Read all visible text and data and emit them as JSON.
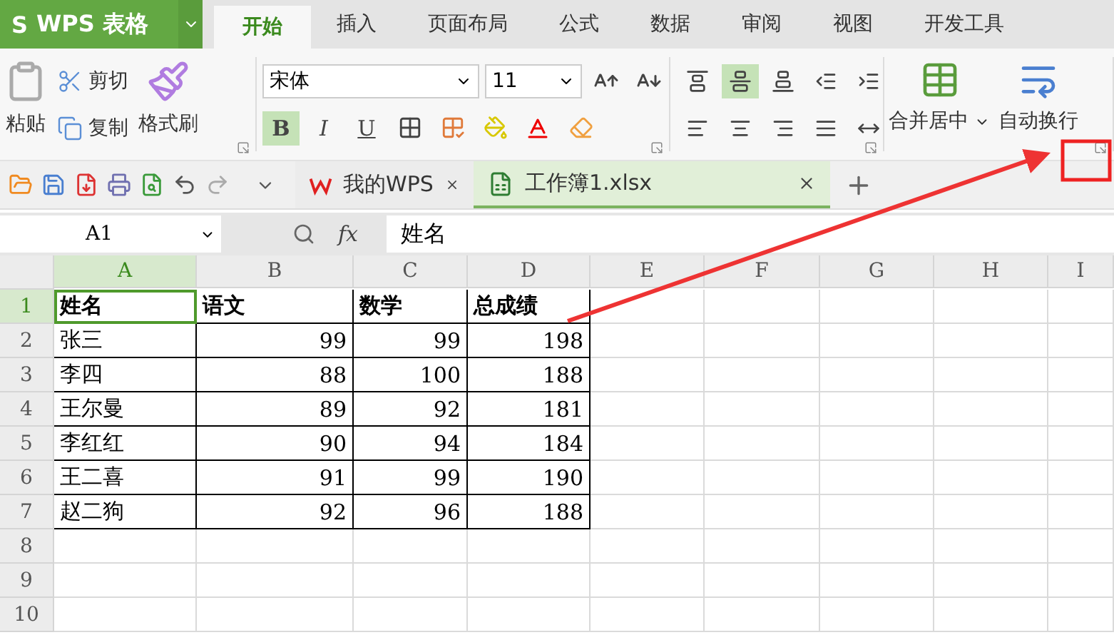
{
  "app": {
    "logo_mark": "S",
    "logo": "WPS 表格"
  },
  "tabs": [
    {
      "label": "开始",
      "selected": true
    },
    {
      "label": "插入",
      "selected": false
    },
    {
      "label": "页面布局",
      "selected": false
    },
    {
      "label": "公式",
      "selected": false
    },
    {
      "label": "数据",
      "selected": false
    },
    {
      "label": "审阅",
      "selected": false
    },
    {
      "label": "视图",
      "selected": false
    },
    {
      "label": "开发工具",
      "selected": false
    }
  ],
  "ribbon": {
    "paste": "粘贴",
    "cut": "剪切",
    "copy": "复制",
    "format_painter": "格式刷",
    "font_name": "宋体",
    "font_size": "11",
    "styles": [
      {
        "label": "B",
        "kind": "bold",
        "selected": true
      },
      {
        "label": "I",
        "kind": "italic",
        "selected": false
      },
      {
        "label": "U",
        "kind": "underline",
        "selected": false
      }
    ],
    "vertical_align": [
      {
        "kind": "top",
        "selected": false
      },
      {
        "kind": "middle",
        "selected": true
      },
      {
        "kind": "bottom",
        "selected": false
      }
    ],
    "merge": "合并居中",
    "wrap": "自动换行"
  },
  "doc_tabs": [
    {
      "label": "我的WPS",
      "selected": false
    },
    {
      "label": "工作簿1.xlsx",
      "selected": true
    }
  ],
  "formula_bar": {
    "cell_ref": "A1",
    "fx": "fx",
    "value": "姓名"
  },
  "sheet": {
    "columns": [
      {
        "label": "A",
        "selected": true
      },
      {
        "label": "B",
        "selected": false
      },
      {
        "label": "C",
        "selected": false
      },
      {
        "label": "D",
        "selected": false
      },
      {
        "label": "E",
        "selected": false
      },
      {
        "label": "F",
        "selected": false
      },
      {
        "label": "G",
        "selected": false
      },
      {
        "label": "H",
        "selected": false
      },
      {
        "label": "I",
        "selected": false
      }
    ],
    "rows": [
      {
        "label": "1",
        "kind": "header",
        "selected": true,
        "cells": [
          "姓名",
          "语文",
          "数学",
          "总成绩"
        ]
      },
      {
        "label": "2",
        "kind": "data",
        "selected": false,
        "cells": [
          "张三",
          "99",
          "99",
          "198"
        ]
      },
      {
        "label": "3",
        "kind": "data",
        "selected": false,
        "cells": [
          "李四",
          "88",
          "100",
          "188"
        ]
      },
      {
        "label": "4",
        "kind": "data",
        "selected": false,
        "cells": [
          "王尔曼",
          "89",
          "92",
          "181"
        ]
      },
      {
        "label": "5",
        "kind": "data",
        "selected": false,
        "cells": [
          "李红红",
          "90",
          "94",
          "184"
        ]
      },
      {
        "label": "6",
        "kind": "data",
        "selected": false,
        "cells": [
          "王二喜",
          "91",
          "99",
          "190"
        ]
      },
      {
        "label": "7",
        "kind": "data",
        "selected": false,
        "cells": [
          "赵二狗",
          "92",
          "96",
          "188"
        ]
      },
      {
        "label": "8",
        "kind": "data",
        "selected": false,
        "cells": []
      },
      {
        "label": "9",
        "kind": "data",
        "selected": false,
        "cells": []
      },
      {
        "label": "10",
        "kind": "data",
        "selected": false,
        "cells": []
      }
    ]
  },
  "annotation": {
    "kind": "arrow"
  }
}
